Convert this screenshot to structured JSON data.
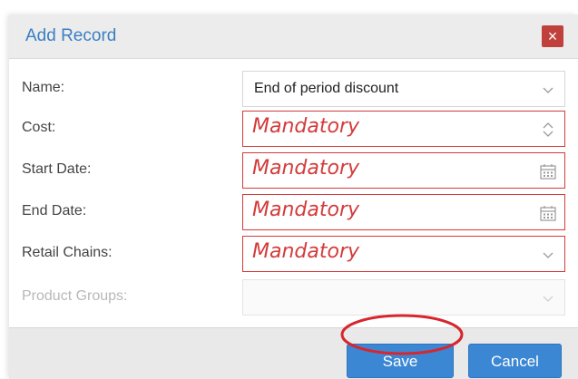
{
  "dialog": {
    "title": "Add Record",
    "close_glyph": "×"
  },
  "form": {
    "fields": [
      {
        "label": "Name:",
        "value": "End of period discount",
        "state": "filled",
        "icon": "chevron-down-icon"
      },
      {
        "label": "Cost:",
        "placeholder": "Mandatory",
        "state": "mandatory",
        "icon": "spinner-icon"
      },
      {
        "label": "Start Date:",
        "placeholder": "Mandatory",
        "state": "mandatory",
        "icon": "calendar-icon"
      },
      {
        "label": "End Date:",
        "placeholder": "Mandatory",
        "state": "mandatory",
        "icon": "calendar-icon"
      },
      {
        "label": "Retail Chains:",
        "placeholder": "Mandatory",
        "state": "mandatory",
        "icon": "chevron-down-icon"
      },
      {
        "label": "Product Groups:",
        "value": "",
        "state": "disabled",
        "icon": "chevron-down-icon"
      }
    ]
  },
  "footer": {
    "save_label": "Save",
    "cancel_label": "Cancel"
  },
  "colors": {
    "accent": "#3b87d4",
    "title": "#3a7fc4",
    "mandatory": "#d43b3b",
    "close": "#c0413c",
    "annotation": "#d7262e"
  }
}
